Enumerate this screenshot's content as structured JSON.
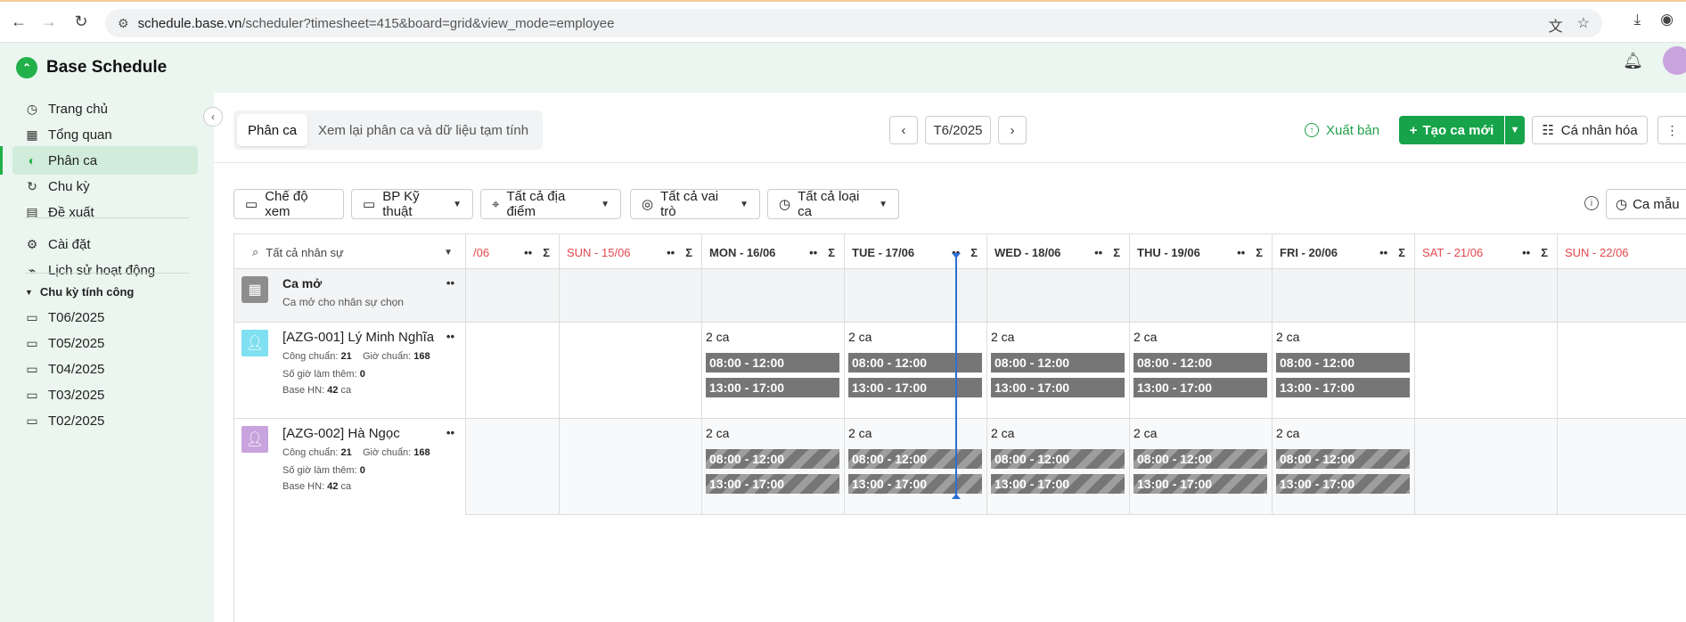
{
  "browser": {
    "url_host": "schedule.base.vn",
    "url_path": "/scheduler?timesheet=415&board=grid&view_mode=employee"
  },
  "app": {
    "title": "Base Schedule"
  },
  "sidebar": {
    "items": [
      {
        "label": "Trang chủ",
        "icon": "clock-icon"
      },
      {
        "label": "Tổng quan",
        "icon": "grid-icon"
      },
      {
        "label": "Phân ca",
        "icon": "shift-icon",
        "active": true
      },
      {
        "label": "Chu kỳ",
        "icon": "refresh-icon"
      },
      {
        "label": "Đề xuất",
        "icon": "document-icon"
      },
      {
        "label": "Cài đặt",
        "icon": "gear-icon"
      },
      {
        "label": "Lịch sử hoạt động",
        "icon": "history-icon"
      }
    ],
    "section_title": "Chu kỳ tính công",
    "periods": [
      "T06/2025",
      "T05/2025",
      "T04/2025",
      "T03/2025",
      "T02/2025"
    ]
  },
  "toolbar": {
    "tab_assign": "Phân ca",
    "tab_review": "Xem lại phân ca và dữ liệu tạm tính",
    "period_label": "T6/2025",
    "export_label": "Xuất bản",
    "create_label": "Tạo ca mới",
    "personalize_label": "Cá nhân hóa"
  },
  "filters": {
    "view_mode": "Chế độ xem",
    "department": "BP Kỹ thuật",
    "location": "Tất cả địa điểm",
    "role": "Tất cả vai trò",
    "shift_type": "Tất cả loại ca",
    "template": "Ca mẫu"
  },
  "grid": {
    "search_placeholder": "Tất cả nhân sự",
    "days": [
      {
        "label": "/06",
        "weekend": true
      },
      {
        "label": "SUN - 15/06",
        "weekend": true
      },
      {
        "label": "MON - 16/06",
        "weekend": false
      },
      {
        "label": "TUE - 17/06",
        "weekend": false
      },
      {
        "label": "WED - 18/06",
        "weekend": false
      },
      {
        "label": "THU - 19/06",
        "weekend": false
      },
      {
        "label": "FRI - 20/06",
        "weekend": false
      },
      {
        "label": "SAT - 21/06",
        "weekend": true
      },
      {
        "label": "SUN - 22/06",
        "weekend": true
      }
    ],
    "open_shift": {
      "title": "Ca mở",
      "subtitle": "Ca mở cho nhân sự chọn"
    },
    "employees": [
      {
        "name": "[AZG-001] Lý Minh Nghĩa",
        "standard_days_label": "Công chuẩn:",
        "standard_days": "21",
        "standard_hours_label": "Giờ chuẩn:",
        "standard_hours": "168",
        "overtime_label": "Số giờ làm thêm:",
        "overtime": "0",
        "base_label": "Base HN:",
        "base_value": "42",
        "base_unit": "ca",
        "avatar_color": "#7ee0f0",
        "shift_count": "2 ca",
        "shifts": [
          "08:00 - 12:00",
          "13:00 - 17:00"
        ]
      },
      {
        "name": "[AZG-002] Hà Ngọc",
        "standard_days_label": "Công chuẩn:",
        "standard_days": "21",
        "standard_hours_label": "Giờ chuẩn:",
        "standard_hours": "168",
        "overtime_label": "Số giờ làm thêm:",
        "overtime": "0",
        "base_label": "Base HN:",
        "base_value": "42",
        "base_unit": "ca",
        "avatar_color": "#c9a3dd",
        "shift_count": "2 ca",
        "shifts": [
          "08:00 - 12:00",
          "13:00 - 17:00"
        ]
      }
    ]
  },
  "colors": {
    "accent": "#16a34a",
    "weekend": "#e5484d",
    "today": "#2b6fd6"
  }
}
